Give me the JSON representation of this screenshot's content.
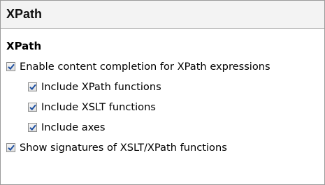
{
  "panel": {
    "title": "XPath"
  },
  "section": {
    "heading": "XPath"
  },
  "options": {
    "enable_completion": {
      "label": "Enable content completion for XPath expressions",
      "checked": true
    },
    "include_xpath_functions": {
      "label": "Include XPath functions",
      "checked": true
    },
    "include_xslt_functions": {
      "label": "Include XSLT functions",
      "checked": true
    },
    "include_axes": {
      "label": "Include axes",
      "checked": true
    },
    "show_signatures": {
      "label": "Show signatures of XSLT/XPath functions",
      "checked": true
    }
  },
  "colors": {
    "check": "#1c4ea0"
  },
  "icons": {
    "checkbox_mark": "checkmark-icon"
  }
}
